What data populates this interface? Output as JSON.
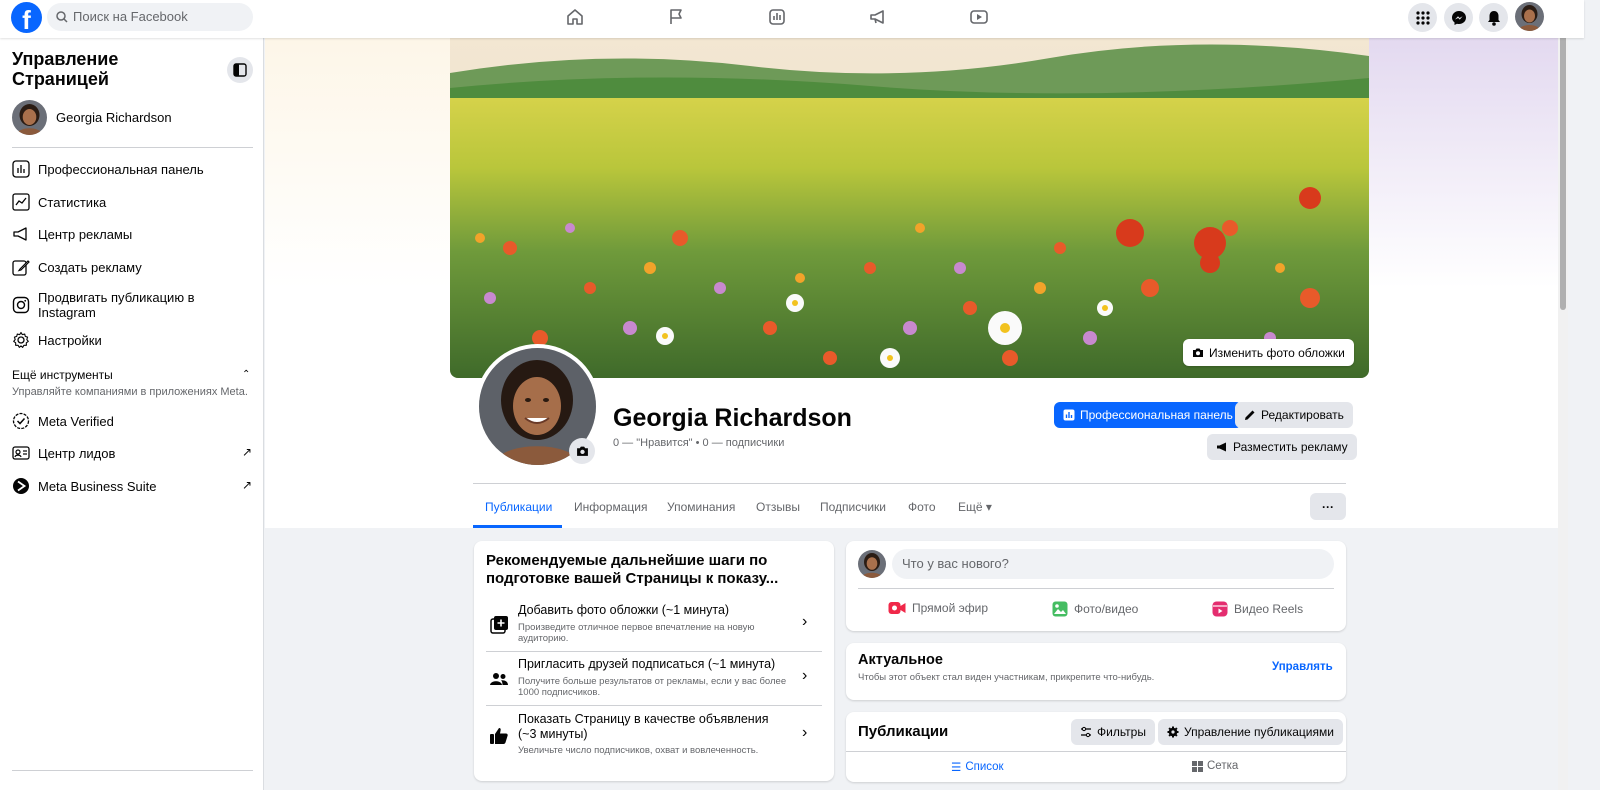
{
  "topbar": {
    "logo": "f",
    "search_placeholder": "Поиск на Facebook",
    "nav_icons": [
      "home-icon",
      "flag-icon",
      "insights-icon",
      "megaphone-icon",
      "video-icon"
    ],
    "right_icons": [
      "menu-grid-icon",
      "messenger-icon",
      "bell-icon"
    ]
  },
  "sidebar": {
    "title": "Управление Страницей",
    "profile_name": "Georgia Richardson",
    "items": [
      {
        "label": "Профессиональная панель",
        "icon": "dashboard-icon"
      },
      {
        "label": "Статистика",
        "icon": "stats-icon"
      },
      {
        "label": "Центр рекламы",
        "icon": "megaphone-icon"
      },
      {
        "label": "Создать рекламу",
        "icon": "pencil-icon"
      },
      {
        "label": "Продвигать публикацию в Instagram",
        "icon": "instagram-icon"
      },
      {
        "label": "Настройки",
        "icon": "gear-icon"
      }
    ],
    "more_tools_title": "Ещё инструменты",
    "more_tools_sub": "Управляйте компаниями в приложениях Meta.",
    "tools": [
      {
        "label": "Meta Verified",
        "icon": "verified-icon"
      },
      {
        "label": "Центр лидов",
        "icon": "leads-icon",
        "external": "↗"
      },
      {
        "label": "Meta Business Suite",
        "icon": "business-suite-icon",
        "external": "↗"
      }
    ]
  },
  "profile": {
    "cover_button": "Изменить фото обложки",
    "name": "Georgia Richardson",
    "stats": "0 — \"Нравится\" • 0 — подписчики",
    "btn_pro": "Профессиональная панель",
    "btn_edit": "Редактировать",
    "btn_ad": "Разместить рекламу"
  },
  "tabs": [
    "Публикации",
    "Информация",
    "Упоминания",
    "Отзывы",
    "Подписчики",
    "Фото",
    "Ещё ▾"
  ],
  "recommend": {
    "title": "Рекомендуемые дальнейшие шаги по подготовке вашей Страницы к показу...",
    "items": [
      {
        "title": "Добавить фото обложки (~1 минута)",
        "sub": "Произведите отличное первое впечатление на новую аудиторию."
      },
      {
        "title": "Пригласить друзей подписаться (~1 минута)",
        "sub": "Получите больше результатов от рекламы, если у вас более 1000 подписчиков."
      },
      {
        "title": "Показать Страницу в качестве объявления (~3 минуты)",
        "sub": "Увеличьте число подписчиков, охват и вовлеченность."
      }
    ]
  },
  "composer": {
    "placeholder": "Что у вас нового?",
    "live": "Прямой эфир",
    "photo": "Фото/видео",
    "reels": "Видео Reels"
  },
  "featured": {
    "title": "Актуальное",
    "sub": "Чтобы этот объект стал виден участникам, прикрепите что-нибудь.",
    "manage": "Управлять"
  },
  "posts": {
    "title": "Публикации",
    "filters": "Фильтры",
    "manage": "Управление публикациями",
    "view_list": "Список",
    "view_grid": "Сетка"
  },
  "colors": {
    "brand": "#0866ff",
    "bg": "#f0f2f5",
    "secondary_text": "#65676b"
  }
}
